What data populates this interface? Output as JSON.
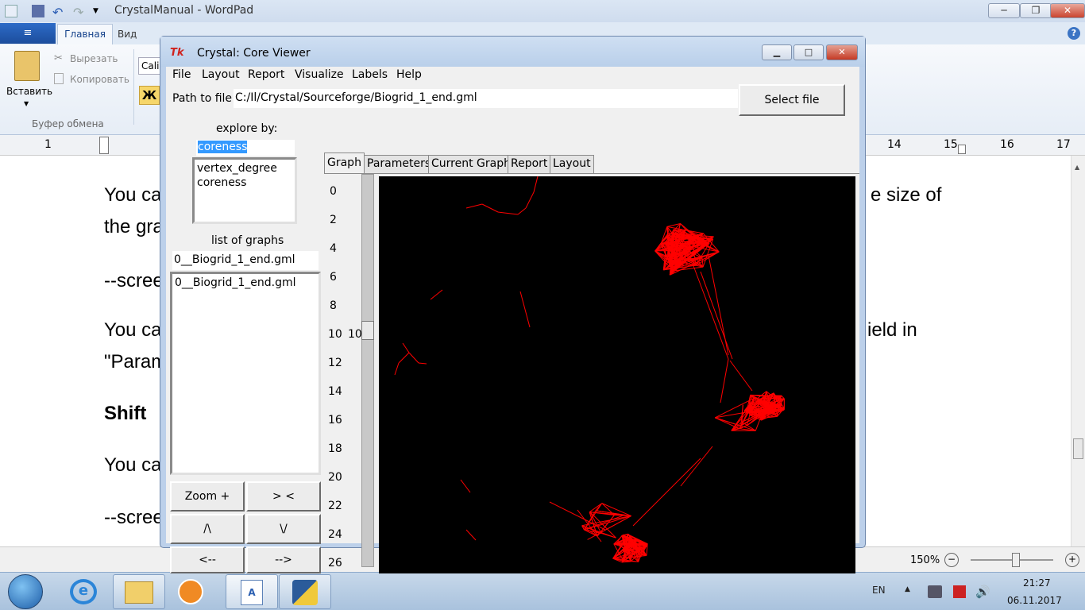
{
  "wordpad": {
    "title": "CrystalManual - WordPad",
    "tabs": {
      "file_glyph": "≡",
      "home": "Главная",
      "view": "Вид"
    },
    "clipboard": {
      "paste": "Вставить",
      "cut": "Вырезать",
      "copy": "Копировать",
      "group": "Буфер обмена"
    },
    "font_name_partial": "Cali",
    "bold_glyph": "Ж",
    "ruler_numbers": [
      "1",
      "14",
      "15",
      "16",
      "17"
    ],
    "doc_text": {
      "l1a": "You ca",
      "l1b": "e size of",
      "l2": "the gra",
      "l3": "--scree",
      "l4a": "You ca",
      "l4b": "ield in",
      "l5": "\"Param",
      "l6": "Shift",
      "l7": "You ca",
      "l8": "--scree"
    },
    "zoom": "150%"
  },
  "taskbar": {
    "lang": "EN",
    "time": "21:27",
    "date": "06.11.2017"
  },
  "tk": {
    "title": "Crystal:  Core Viewer",
    "logo": "Tk",
    "menu": [
      "File",
      "Layout",
      "Report",
      "Visualize",
      "Labels",
      "Help"
    ],
    "path_label": "Path to file",
    "path_value": "C:/Il/Crystal/Sourceforge/Biogrid_1_end.gml",
    "select_button": "Select file",
    "explore_label": "explore by:",
    "explore_value": "coreness",
    "explore_options": [
      "vertex_degree",
      "coreness"
    ],
    "graphs_label": "list of graphs",
    "graph_value": "0__Biogrid_1_end.gml",
    "graph_items": [
      "0__Biogrid_1_end.gml"
    ],
    "buttons": {
      "zoom": "Zoom +",
      "shrink": "> <",
      "up": "/\\",
      "down": "\\/",
      "left": "<--",
      "right": "-->"
    },
    "tabs": [
      "Graph",
      "Parameters",
      "Current Graph",
      "Report",
      "Layout"
    ],
    "slider_ticks": [
      "0",
      "2",
      "4",
      "6",
      "8",
      "10",
      "12",
      "14",
      "16",
      "18",
      "20",
      "22",
      "24",
      "26"
    ],
    "slider_value": "10",
    "graph_color": "#ff0000"
  }
}
